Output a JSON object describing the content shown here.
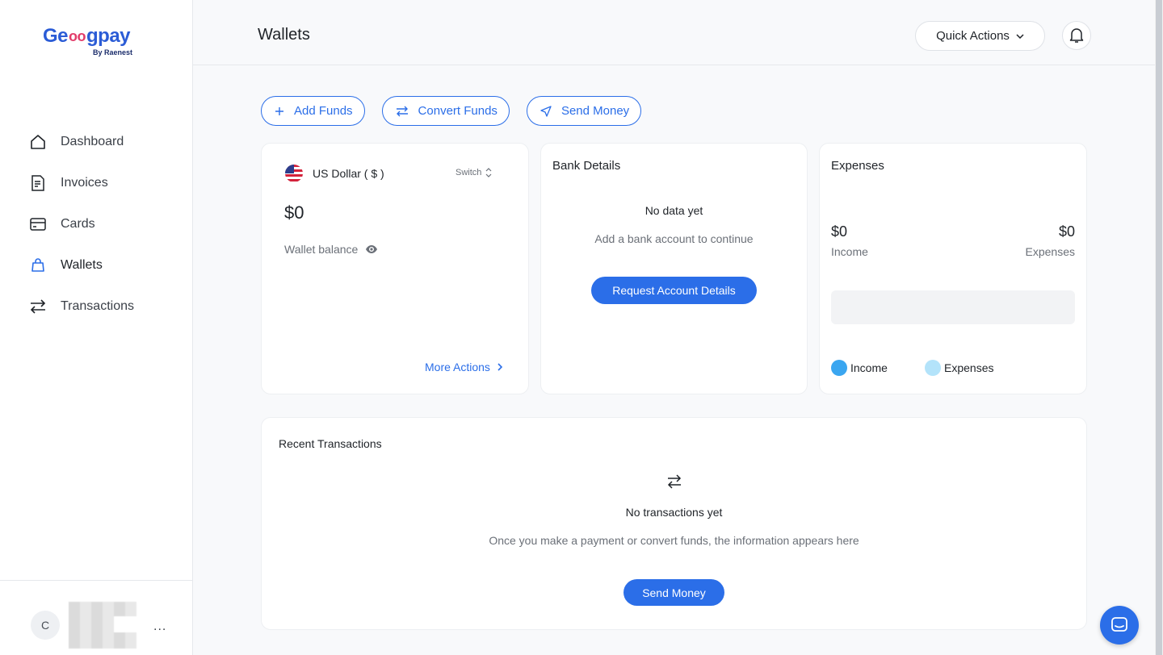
{
  "brand": {
    "logo_prefix": "Ge",
    "logo_suffix": "gpay",
    "logo_sub": "By Raenest"
  },
  "sidebar": {
    "items": [
      {
        "label": "Dashboard",
        "icon": "home-icon"
      },
      {
        "label": "Invoices",
        "icon": "document-icon"
      },
      {
        "label": "Cards",
        "icon": "card-icon"
      },
      {
        "label": "Wallets",
        "icon": "wallet-icon",
        "active": true
      },
      {
        "label": "Transactions",
        "icon": "transfer-icon"
      }
    ],
    "user": {
      "initial": "C",
      "more": "..."
    }
  },
  "header": {
    "title": "Wallets",
    "quick_actions": "Quick Actions"
  },
  "actions": {
    "add_funds": "Add Funds",
    "convert_funds": "Convert Funds",
    "send_money": "Send Money"
  },
  "wallet": {
    "currency": "US Dollar ( $ )",
    "switch": "Switch",
    "balance": "$0",
    "balance_label": "Wallet balance",
    "more_actions": "More Actions"
  },
  "bank": {
    "title": "Bank Details",
    "empty_title": "No data yet",
    "empty_sub": "Add a bank account to continue",
    "button": "Request Account Details"
  },
  "expenses": {
    "title": "Expenses",
    "income_value": "$0",
    "income_label": "Income",
    "expenses_value": "$0",
    "expenses_label": "Expenses",
    "legend_income": "Income",
    "legend_expenses": "Expenses",
    "income_color": "#3aa6f0",
    "expenses_color": "#b3e3fa"
  },
  "transactions": {
    "title": "Recent Transactions",
    "empty_title": "No transactions yet",
    "empty_sub": "Once you make a payment or convert funds, the information appears here",
    "button": "Send Money"
  },
  "colors": {
    "accent": "#2b6ee8"
  }
}
